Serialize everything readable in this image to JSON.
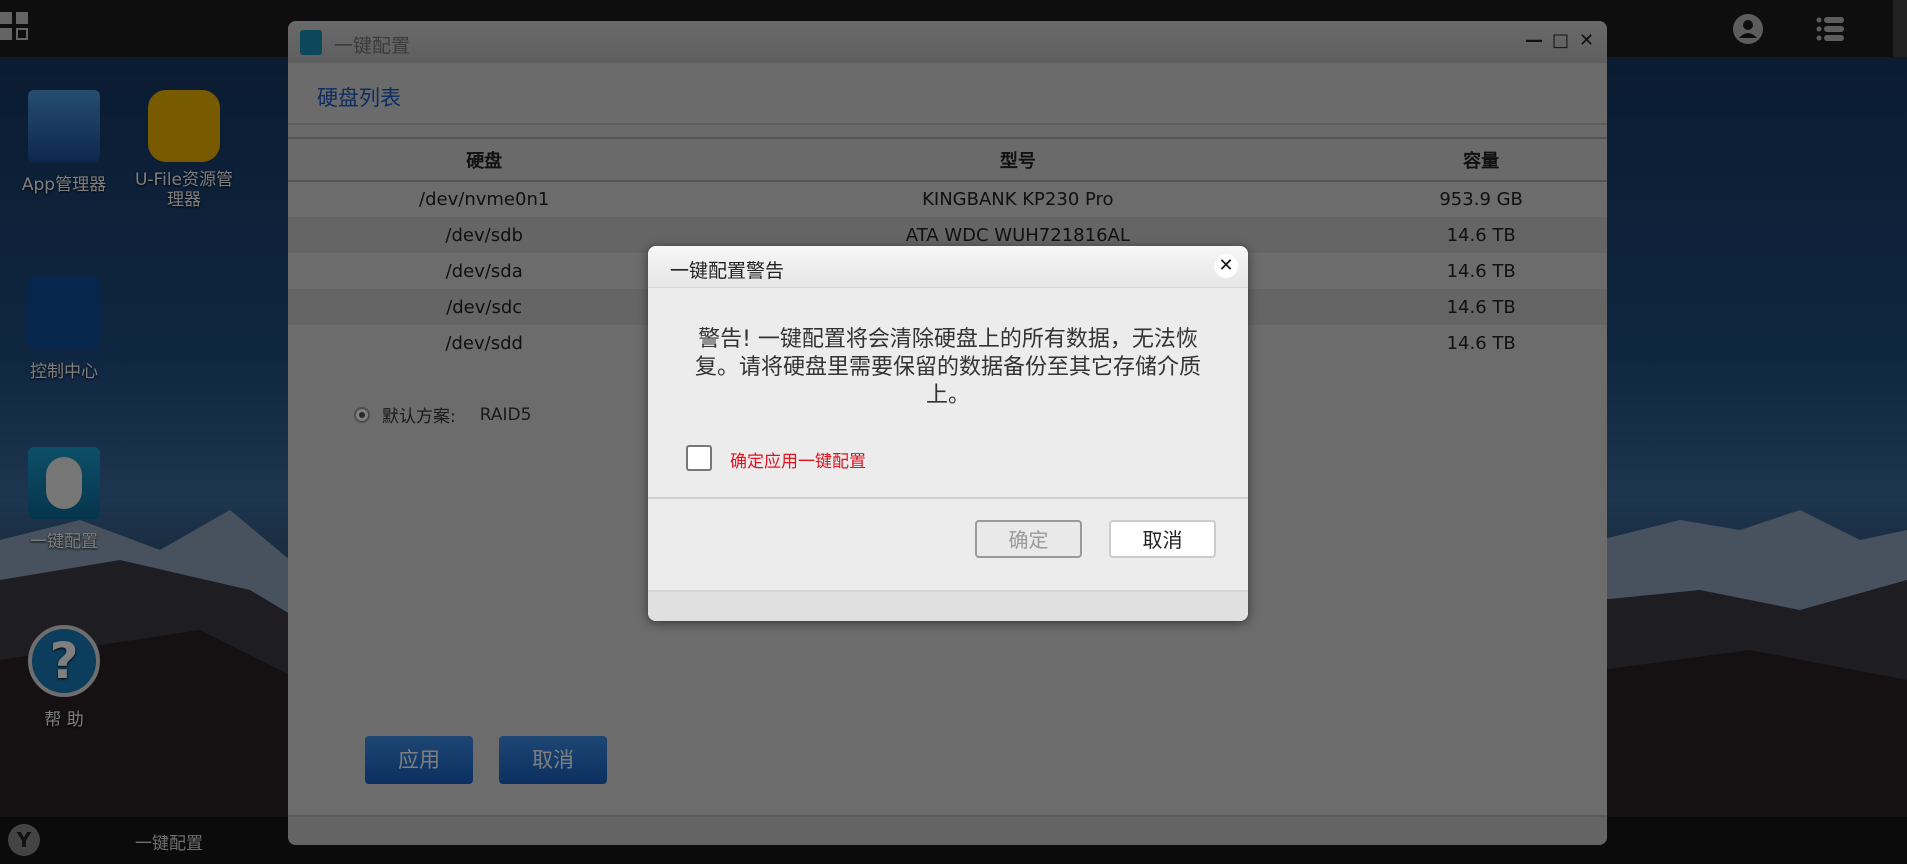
{
  "desktop": {
    "icons": [
      {
        "label": "App管理器",
        "icon": "app-store-icon"
      },
      {
        "label": "U-File资源管理器",
        "icon": "folder-icon"
      },
      {
        "label": "控制中心",
        "icon": "control-center-icon"
      },
      {
        "label": "一键配置",
        "icon": "mouse-icon"
      },
      {
        "label": "帮 助",
        "icon": "help-icon"
      }
    ]
  },
  "taskbar": {
    "app_label": "一键配置",
    "logo_letter": "Y"
  },
  "window": {
    "title": "一键配置",
    "section_title": "硬盘列表",
    "table": {
      "headers": [
        "硬盘",
        "型号",
        "容量"
      ],
      "rows": [
        [
          "/dev/nvme0n1",
          "KINGBANK KP230 Pro",
          "953.9 GB"
        ],
        [
          "/dev/sdb",
          "ATA WDC WUH721816AL",
          "14.6 TB"
        ],
        [
          "/dev/sda",
          "",
          "14.6 TB"
        ],
        [
          "/dev/sdc",
          "",
          "14.6 TB"
        ],
        [
          "/dev/sdd",
          "",
          "14.6 TB"
        ]
      ]
    },
    "scheme_label": "默认方案:",
    "scheme_value": "RAID5",
    "apply_label": "应用",
    "cancel_label": "取消"
  },
  "dialog": {
    "title": "一键配置警告",
    "message": "警告! 一键配置将会清除硬盘上的所有数据，无法恢复。请将硬盘里需要保留的数据备份至其它存储介质上。",
    "checkbox_label": "确定应用一键配置",
    "checkbox_checked": false,
    "ok_label": "确定",
    "cancel_label": "取消",
    "close_glyph": "✕"
  },
  "colors": {
    "accent": "#1a59c0",
    "warning": "#e0141e"
  }
}
